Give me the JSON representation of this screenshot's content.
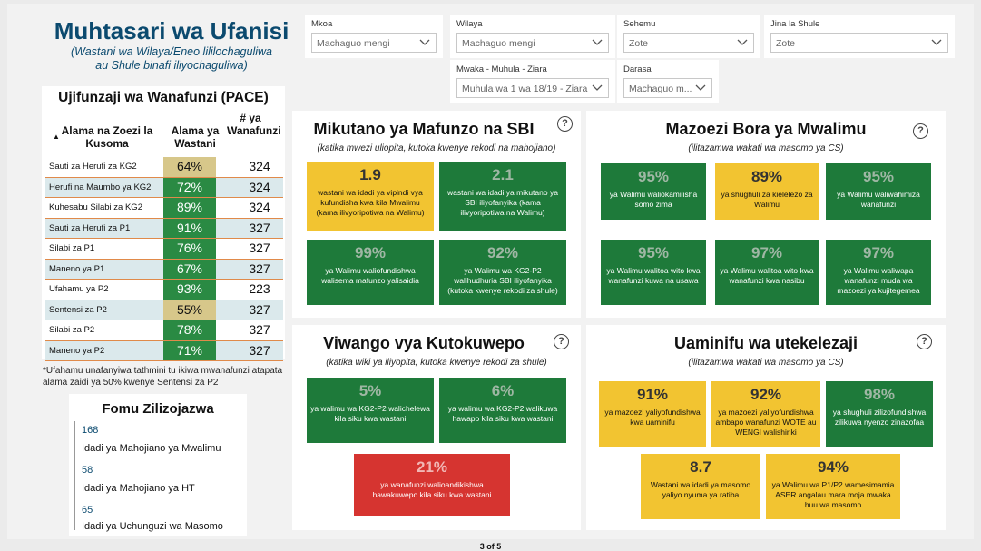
{
  "header": {
    "title": "Muhtasari wa Ufanisi",
    "subtitle_line1": "(Wastani wa Wilaya/Eneo lililochaguliwa",
    "subtitle_line2": "au Shule binafi iliyochaguliwa)"
  },
  "filters": {
    "mkoa": {
      "label": "Mkoa",
      "value": "Machaguo mengi"
    },
    "wilaya": {
      "label": "Wilaya",
      "value": "Machaguo mengi"
    },
    "sehemu": {
      "label": "Sehemu",
      "value": "Zote"
    },
    "shule": {
      "label": "Jina la Shule",
      "value": "Zote"
    },
    "mwaka": {
      "label": "Mwaka - Muhula - Ziara",
      "value": "Muhula wa 1 wa 18/19 - Ziara ya 1"
    },
    "darasa": {
      "label": "Darasa",
      "value": "Machaguo m..."
    }
  },
  "pace": {
    "title": "Ujifunzaji wa Wanafunzi (PACE)",
    "col1": "Alama na Zoezi la Kusoma",
    "col2": "Alama ya Wastani",
    "col3": "# ya Wanafunzi",
    "sort_arrow": "▲",
    "rows": [
      {
        "name": "Sauti za Herufi za KG2",
        "pct": "64%",
        "n": "324"
      },
      {
        "name": "Herufi na Maumbo ya KG2",
        "pct": "72%",
        "n": "324"
      },
      {
        "name": "Kuhesabu Silabi za KG2",
        "pct": "89%",
        "n": "324"
      },
      {
        "name": "Sauti za Herufi za P1",
        "pct": "91%",
        "n": "327"
      },
      {
        "name": "Silabi za P1",
        "pct": "76%",
        "n": "327"
      },
      {
        "name": "Maneno ya P1",
        "pct": "67%",
        "n": "327"
      },
      {
        "name": "Ufahamu ya P2",
        "pct": "93%",
        "n": "223"
      },
      {
        "name": "Sentensi za P2",
        "pct": "55%",
        "n": "327"
      },
      {
        "name": "Silabi za P2",
        "pct": "78%",
        "n": "327"
      },
      {
        "name": "Maneno ya P2",
        "pct": "71%",
        "n": "327"
      }
    ],
    "note": "*Ufahamu unafanyiwa tathmini tu ikiwa mwanafunzi atapata alama zaidi ya 50% kwenye Sentensi za P2"
  },
  "forms": {
    "title": "Fomu Zilizojazwa",
    "items": [
      {
        "count": "168",
        "label": "Idadi ya Mahojiano ya Mwalimu"
      },
      {
        "count": "58",
        "label": "Idadi ya Mahojiano ya HT"
      },
      {
        "count": "65",
        "label": "Idadi ya Uchunguzi wa Masomo"
      }
    ]
  },
  "panels": {
    "sbi": {
      "title": "Mikutano ya Mafunzo na SBI",
      "sub": "(katika mwezi uliopita, kutoka kwenye rekodi na mahojiano)",
      "cards": [
        {
          "value": "1.9",
          "desc": "wastani wa idadi ya vipindi vya kufundisha kwa kila Mwalimu (kama ilivyoripotiwa na Walimu)"
        },
        {
          "value": "2.1",
          "desc": "wastani wa idadi ya mikutano ya SBI iliyofanyika (kama ilivyoripotiwa na Walimu)"
        },
        {
          "value": "99%",
          "desc": "ya Walimu waliofundishwa walisema mafunzo yalisaidia"
        },
        {
          "value": "92%",
          "desc": "ya Walimu wa KG2-P2 walihudhuria SBI iliyofanyika (kutoka kwenye rekodi za shule)"
        }
      ]
    },
    "mazoezi": {
      "title": "Mazoezi Bora ya Mwalimu",
      "sub": "(ilitazamwa wakati wa masomo ya CS)",
      "cards": [
        {
          "value": "95%",
          "desc": "ya Walimu waliokamilisha somo zima"
        },
        {
          "value": "89%",
          "desc": "ya shughuli za kielelezo za Walimu"
        },
        {
          "value": "95%",
          "desc": "ya Walimu waliwahimiza wanafunzi"
        },
        {
          "value": "95%",
          "desc": "ya Walimu walitoa wito kwa wanafunzi kuwa na usawa"
        },
        {
          "value": "97%",
          "desc": "ya Walimu walitoa wito kwa wanafunzi kwa nasibu"
        },
        {
          "value": "97%",
          "desc": "ya Walimu waliwapa wanafunzi muda wa mazoezi ya kujitegemea"
        }
      ]
    },
    "viwango": {
      "title": "Viwango vya Kutokuwepo",
      "sub": "(katika wiki ya iliyopita, kutoka kwenye rekodi za shule)",
      "cards": [
        {
          "value": "5%",
          "desc": "ya walimu wa KG2-P2 walichelewa kila siku kwa wastani"
        },
        {
          "value": "6%",
          "desc": "ya walimu wa KG2-P2 walikuwa hawapo kila siku kwa wastani"
        },
        {
          "value": "21%",
          "desc": "ya wanafunzi walioandikishwa hawakuwepo kila siku kwa wastani"
        }
      ]
    },
    "uaminifu": {
      "title": "Uaminifu wa utekelezaji",
      "sub": "(ilitazamwa wakati wa masomo ya CS)",
      "cards": [
        {
          "value": "91%",
          "desc": "ya mazoezi yaliyofundishwa kwa uaminifu"
        },
        {
          "value": "92%",
          "desc": "ya mazoezi yaliyofundishwa ambapo wanafunzi WOTE au WENGI walishiriki"
        },
        {
          "value": "98%",
          "desc": "ya shughuli zilizofundishwa zilikuwa nyenzo zinazofaa"
        },
        {
          "value": "8.7",
          "desc": "Wastani wa idadi ya masomo yaliyo nyuma ya ratiba"
        },
        {
          "value": "94%",
          "desc": "ya Walimu wa P1/P2 wamesimamia ASER angalau mara moja mwaka huu wa masomo"
        }
      ]
    }
  },
  "help_glyph": "?",
  "pager": "3 of 5",
  "colors": {
    "green": "#1e7a3a",
    "yellow": "#f2c431",
    "red": "#d63430",
    "navy": "#0b4a6f"
  }
}
